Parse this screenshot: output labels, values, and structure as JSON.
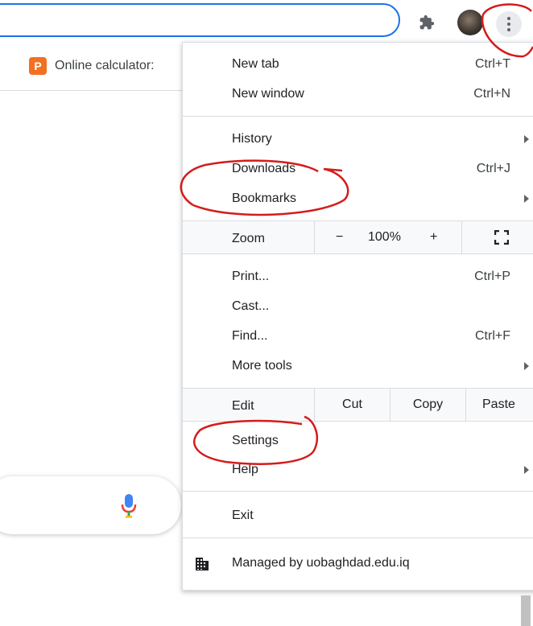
{
  "browser": {
    "bookmarks_bar": [
      {
        "icon": "p-logo-favicon",
        "label": "Online calculator:"
      }
    ]
  },
  "menu": {
    "new_tab": {
      "label": "New tab",
      "shortcut": "Ctrl+T"
    },
    "new_window": {
      "label": "New window",
      "shortcut": "Ctrl+N"
    },
    "history": {
      "label": "History"
    },
    "downloads": {
      "label": "Downloads",
      "shortcut": "Ctrl+J"
    },
    "bookmarks": {
      "label": "Bookmarks"
    },
    "zoom": {
      "label": "Zoom",
      "minus": "−",
      "value": "100%",
      "plus": "+"
    },
    "print": {
      "label": "Print...",
      "shortcut": "Ctrl+P"
    },
    "cast": {
      "label": "Cast..."
    },
    "find": {
      "label": "Find...",
      "shortcut": "Ctrl+F"
    },
    "more_tools": {
      "label": "More tools"
    },
    "edit": {
      "label": "Edit",
      "cut": "Cut",
      "copy": "Copy",
      "paste": "Paste"
    },
    "settings": {
      "label": "Settings"
    },
    "help": {
      "label": "Help"
    },
    "exit": {
      "label": "Exit"
    },
    "managed": {
      "label": "Managed by uobaghdad.edu.iq",
      "icon": "building-icon"
    }
  },
  "colors": {
    "accent": "#1a73e8",
    "annotation": "#d51b1b"
  }
}
